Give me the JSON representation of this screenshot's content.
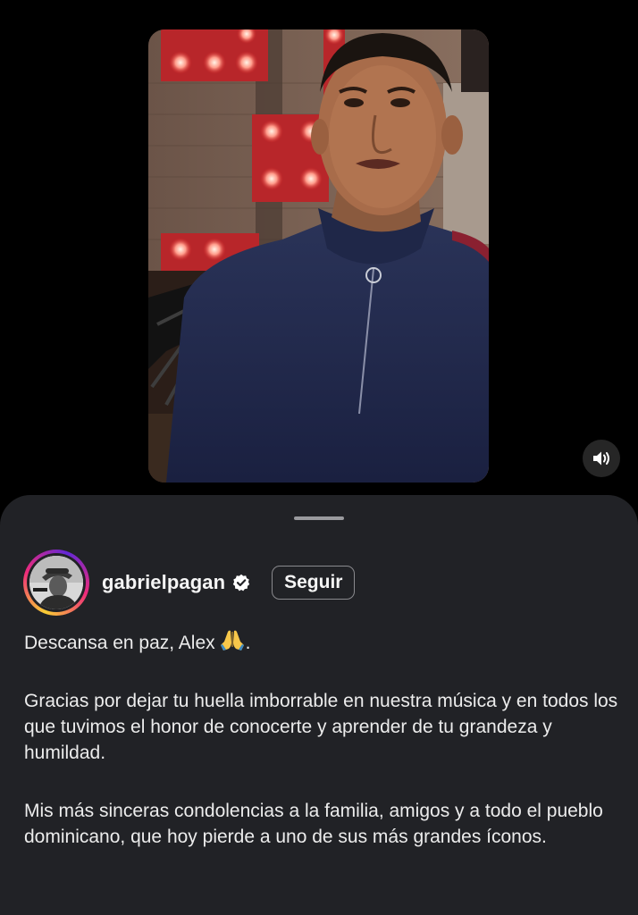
{
  "post": {
    "username": "gabrielpagan",
    "follow_label": "Seguir",
    "verified": true
  },
  "caption": {
    "line1_text": "Descansa en paz, Alex",
    "line1_emoji": "folded-hands-emoji",
    "line1_end": ".",
    "paragraph2": "Gracias por dejar tu huella imborrable en nuestra música y en todos los que tuvimos el honor de conocerte y aprender de tu grandeza y humildad.",
    "paragraph3": "Mis más sinceras condolencias a la familia, amigos y a todo el pueblo dominicano, que hoy pierde a uno de sus más grandes íconos."
  },
  "icons": {
    "sound": "speaker-icon",
    "verified": "verified-badge-icon"
  },
  "colors": {
    "background": "#000000",
    "sheet": "#212226",
    "text": "#ececec",
    "verified_badge": "#ffffff"
  }
}
